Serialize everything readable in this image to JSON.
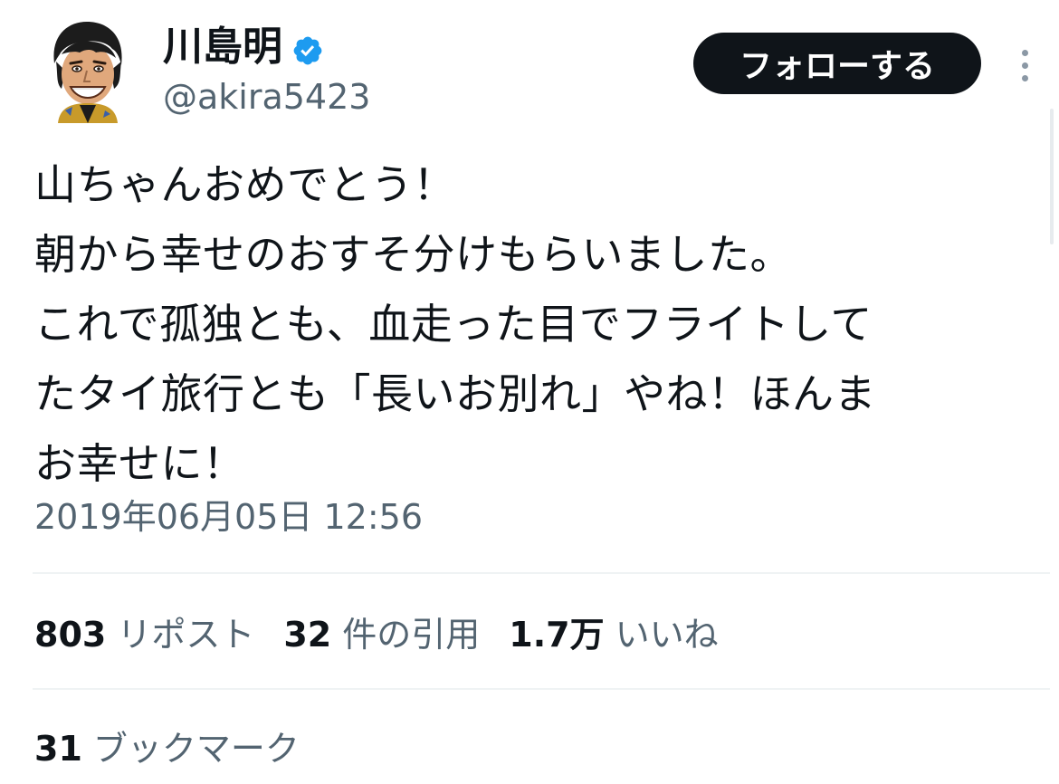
{
  "author": {
    "display_name": "川島明",
    "handle": "@akira5423",
    "verified_color": "#1d9bf0",
    "avatar_icon": "caricature-avatar"
  },
  "actions": {
    "follow_label": "フォローする",
    "more_icon": "vertical-dots-icon"
  },
  "tweet": {
    "lines": [
      "山ちゃんおめでとう！",
      "朝から幸せのおすそ分けもらいました。",
      "これで孤独とも、血走った目でフライトして",
      "たタイ旅行とも「長いお別れ」やね！ほんま",
      "お幸せに！"
    ],
    "timestamp": "2019年06月05日 12:56"
  },
  "stats": {
    "reposts": {
      "count": "803",
      "label": "リポスト"
    },
    "quotes": {
      "count": "32",
      "label": "件の引用"
    },
    "likes": {
      "count": "1.7万",
      "label": "いいね"
    },
    "bookmarks": {
      "count": "31",
      "label": "ブックマーク"
    }
  },
  "colors": {
    "text_primary": "#0f1419",
    "text_secondary": "#536471",
    "divider": "#eff3f4",
    "button_bg": "#0f1419"
  }
}
